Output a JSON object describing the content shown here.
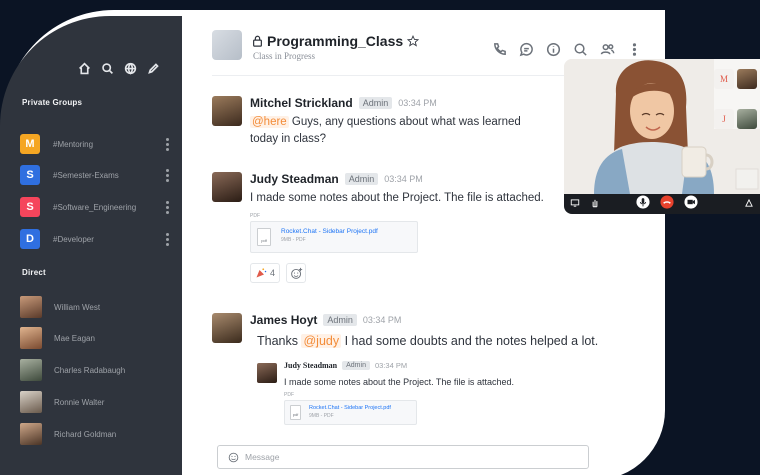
{
  "colors": {
    "sidebar": "#2f343d",
    "page_bg": "#0b1424",
    "mention": "#f38c39",
    "link": "#1d74f5"
  },
  "sidebar": {
    "header_icons": [
      "home-icon",
      "search-icon",
      "globe-icon",
      "pencil-icon"
    ],
    "private_groups_title": "Private Groups",
    "groups": [
      {
        "badge": "M",
        "color": "#f5a623",
        "name": "#Mentoring"
      },
      {
        "badge": "S",
        "color": "#2f6fe0",
        "name": "#Semester-Exams"
      },
      {
        "badge": "S",
        "color": "#f5455c",
        "name": "#Software_Engineering"
      },
      {
        "badge": "D",
        "color": "#2f6fe0",
        "name": "#Developer"
      }
    ],
    "direct_title": "Direct",
    "direct": [
      {
        "name": "William West"
      },
      {
        "name": "Mae Eagan"
      },
      {
        "name": "Charles Radabaugh"
      },
      {
        "name": "Ronnie Walter"
      },
      {
        "name": "Richard Goldman"
      }
    ]
  },
  "room": {
    "title": "Programming_Class",
    "subtitle": "Class in Progress",
    "actions": [
      "phone-icon",
      "threads-icon",
      "info-icon",
      "search-icon",
      "members-icon",
      "kebab-icon"
    ]
  },
  "messages": [
    {
      "author": "Mitchel Strickland",
      "role": "Admin",
      "time": "03:34 PM",
      "mention": "@here",
      "text": "Guys, any questions about what was learned",
      "text2": "today in class?"
    },
    {
      "author": "Judy Steadman",
      "role": "Admin",
      "time": "03:34 PM",
      "text": "I made some notes about the Project. The file is attached.",
      "attachment_label": "PDF",
      "attachment_name": "Rocket.Chat - Sidebar Project.pdf",
      "attachment_size": "9MB - PDF",
      "file_icon_text": "pdf",
      "reaction_count": "4"
    },
    {
      "author": "James Hoyt",
      "role": "Admin",
      "time": "03:34 PM",
      "prefix": "Thanks",
      "mention": "@judy",
      "text": "I had some doubts and the notes helped a lot.",
      "quote": {
        "author": "Judy Steadman",
        "role": "Admin",
        "time": "03:34 PM",
        "text": "I made some notes about the Project. The file is attached.",
        "attachment_label": "PDF",
        "attachment_name": "Rocket.Chat - Sidebar Project.pdf",
        "attachment_size": "9MB - PDF",
        "file_icon_text": "pdf"
      }
    }
  ],
  "composer": {
    "placeholder": "Message"
  },
  "video": {
    "participants": [
      "M",
      "J"
    ],
    "controls": [
      "screen-share-icon",
      "raise-hand-icon",
      "mic-icon",
      "hangup-icon",
      "camera-icon",
      "settings-icon"
    ]
  }
}
